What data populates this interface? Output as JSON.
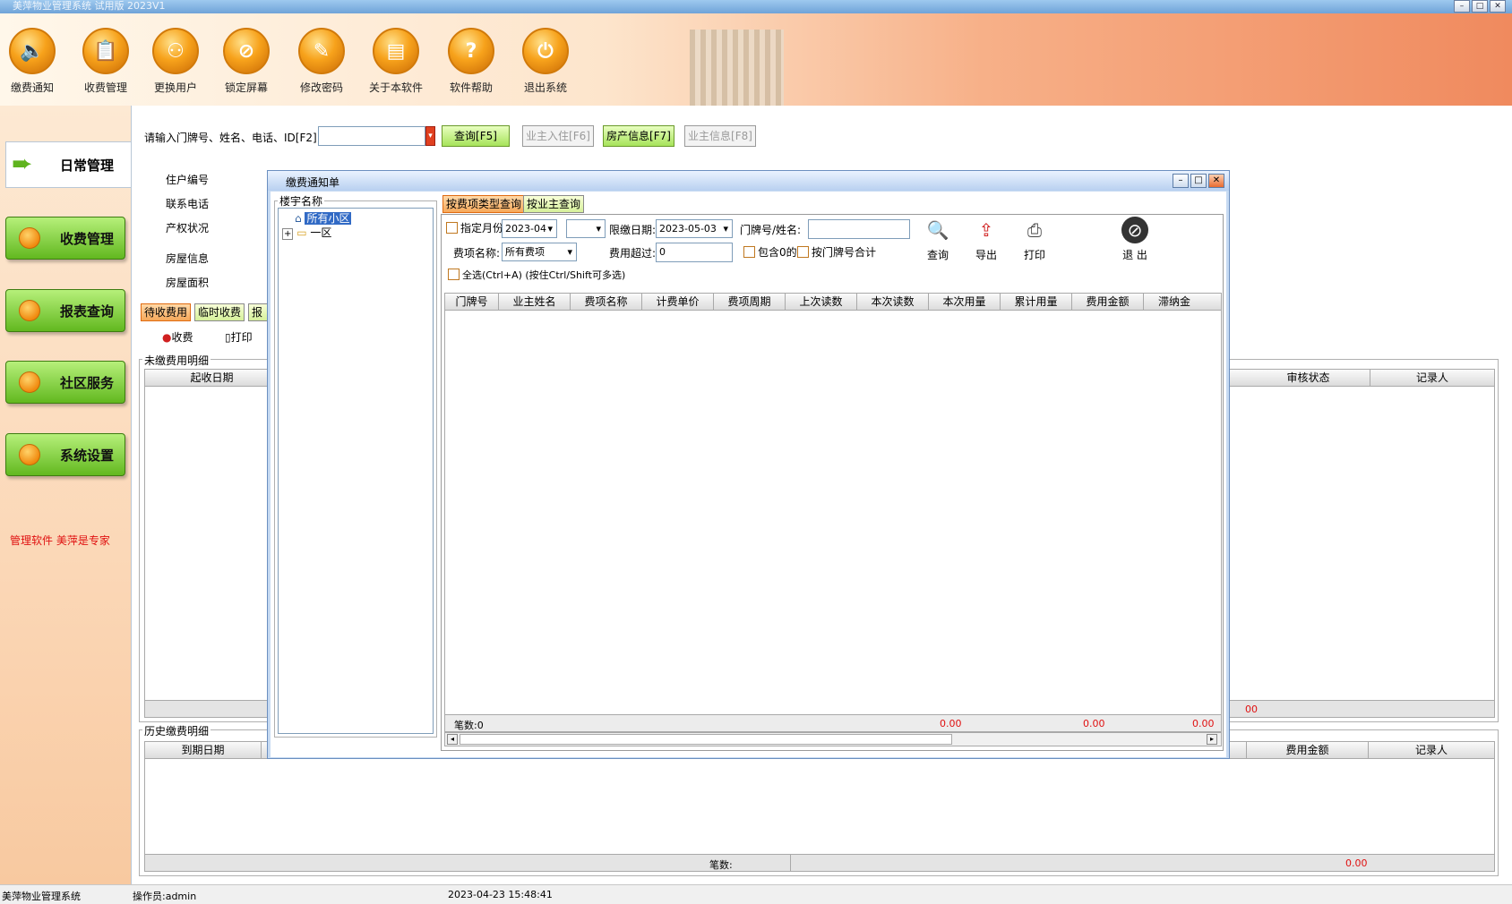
{
  "window": {
    "title": "美萍物业管理系统 试用版 2023V1"
  },
  "toolbar": [
    {
      "label": "缴费通知",
      "icon": "speaker-icon",
      "glyph": "🔈"
    },
    {
      "label": "收费管理",
      "icon": "clipboard-icon",
      "glyph": "📋"
    },
    {
      "label": "更换用户",
      "icon": "user-switch-icon",
      "glyph": "⚇"
    },
    {
      "label": "锁定屏幕",
      "icon": "lock-screen-icon",
      "glyph": "⊘"
    },
    {
      "label": "修改密码",
      "icon": "key-icon",
      "glyph": "✎"
    },
    {
      "label": "关于本软件",
      "icon": "document-icon",
      "glyph": "▤"
    },
    {
      "label": "软件帮助",
      "icon": "help-icon",
      "glyph": "?"
    },
    {
      "label": "退出系统",
      "icon": "power-icon",
      "glyph": "⏻"
    }
  ],
  "sidebar": {
    "items": [
      "日常管理",
      "收费管理",
      "报表查询",
      "社区服务",
      "系统设置"
    ],
    "slogan": "管理软件 美萍是专家"
  },
  "search": {
    "label": "请输入门牌号、姓名、电话、ID[F2]",
    "value": "",
    "query_btn": "查询[F5]",
    "checkin_btn": "业主入住[F6]",
    "house_btn": "房产信息[F7]",
    "owner_btn": "业主信息[F8]"
  },
  "info": {
    "fields": [
      "住户编号",
      "联系电话",
      "产权状况",
      "房屋信息",
      "房屋面积"
    ]
  },
  "fee_tabs": [
    "待收费用",
    "临时收费",
    "报价"
  ],
  "actions": {
    "collect": "收费",
    "print": "打印"
  },
  "unpaid": {
    "title": "未缴费用明细",
    "col_left": "起收日期",
    "col_audit": "审核状态",
    "col_recorder": "记录人",
    "foot_tail": "00"
  },
  "history": {
    "title": "历史缴费明细",
    "col_left": "到期日期",
    "col_amount": "费用金额",
    "col_recorder": "记录人",
    "count_label": "笔数:",
    "total": "0.00"
  },
  "dialog": {
    "title": "缴费通知单",
    "tree_label": "楼宇名称",
    "tree": [
      "所有小区",
      "一区"
    ],
    "tabs": [
      "按费项类型查询",
      "按业主查询"
    ],
    "filters": {
      "month_label": "指定月份",
      "month_value": "2023-04",
      "second_value": "",
      "deadline_label": "限缴日期:",
      "deadline_value": "2023-05-03",
      "door_label": "门牌号/姓名:",
      "door_value": "",
      "fee_label": "费项名称:",
      "fee_value": "所有费项",
      "exceed_label": "费用超过:",
      "exceed_value": "0",
      "include_zero": "包含0的",
      "by_door": "按门牌号合计",
      "select_all": "全选(Ctrl+A)  (按住Ctrl/Shift可多选)"
    },
    "tools": [
      {
        "label": "查询",
        "icon": "magnifier-icon",
        "glyph": "🔍"
      },
      {
        "label": "导出",
        "icon": "export-icon",
        "glyph": "⇪"
      },
      {
        "label": "打印",
        "icon": "printer-icon",
        "glyph": "⎙"
      },
      {
        "label": "退 出",
        "icon": "exit-icon",
        "glyph": "⊘"
      }
    ],
    "columns": [
      "门牌号",
      "业主姓名",
      "费项名称",
      "计费单价",
      "费项周期",
      "上次读数",
      "本次读数",
      "本次用量",
      "累计用量",
      "费用金额",
      "滞纳金"
    ],
    "footer": {
      "count": "笔数:0",
      "sum1": "0.00",
      "sum2": "0.00",
      "sum3": "0.00"
    }
  },
  "status": {
    "app": "美萍物业管理系统",
    "operator": "操作员:admin",
    "datetime": "2023-04-23 15:48:41"
  }
}
